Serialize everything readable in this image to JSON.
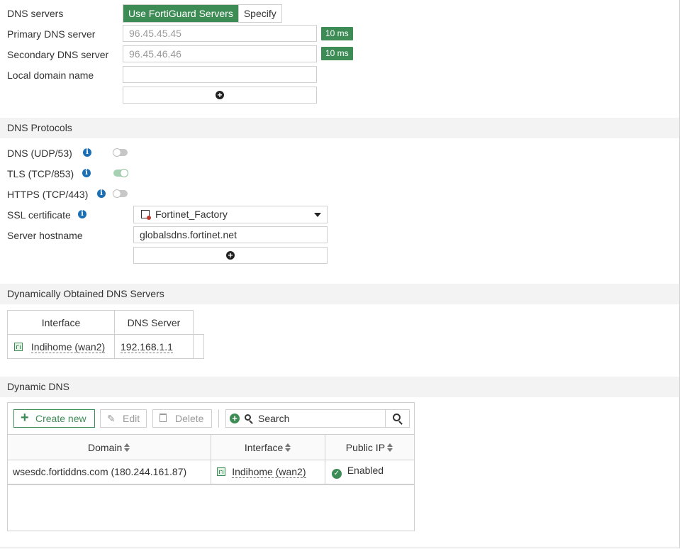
{
  "dns_servers": {
    "label": "DNS servers",
    "mode_active": "Use FortiGuard Servers",
    "mode_other": "Specify",
    "primary_label": "Primary DNS server",
    "primary_value": "96.45.45.45",
    "primary_latency": "10 ms",
    "secondary_label": "Secondary DNS server",
    "secondary_value": "96.45.46.46",
    "secondary_latency": "10 ms",
    "local_domain_label": "Local domain name",
    "local_domain_value": ""
  },
  "dns_protocols": {
    "title": "DNS Protocols",
    "dns_udp_label": "DNS (UDP/53)",
    "dns_udp_enabled": false,
    "tls_label": "TLS (TCP/853)",
    "tls_enabled": true,
    "https_label": "HTTPS (TCP/443)",
    "https_enabled": false,
    "ssl_cert_label": "SSL certificate",
    "ssl_cert_value": "Fortinet_Factory",
    "server_hostname_label": "Server hostname",
    "server_hostname_value": "globalsdns.fortinet.net"
  },
  "dynamic_dns_servers": {
    "title": "Dynamically Obtained DNS Servers",
    "columns": [
      "Interface",
      "DNS Server"
    ],
    "rows": [
      {
        "interface": "Indihome (wan2)",
        "dns_server": "192.168.1.1"
      }
    ]
  },
  "dynamic_dns": {
    "title": "Dynamic DNS",
    "toolbar": {
      "create_label": "Create new",
      "edit_label": "Edit",
      "delete_label": "Delete",
      "search_placeholder": "Search"
    },
    "columns": [
      "Domain",
      "Interface",
      "Public IP"
    ],
    "rows": [
      {
        "domain": "wsesdc.fortiddns.com (180.244.161.87)",
        "interface": "Indihome (wan2)",
        "public_ip": "Enabled"
      }
    ]
  },
  "colors": {
    "accent": "#3d8c55",
    "info": "#1a6fb5",
    "section_bg": "#f3f3f3"
  }
}
